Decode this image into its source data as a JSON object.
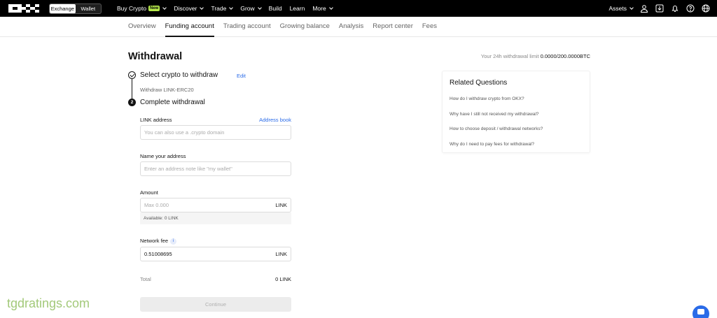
{
  "header": {
    "toggle": {
      "exchange": "Exchange",
      "wallet": "Wallet"
    },
    "nav": [
      {
        "label": "Buy Crypto",
        "badge": "New",
        "dropdown": true
      },
      {
        "label": "Discover",
        "dropdown": true
      },
      {
        "label": "Trade",
        "dropdown": true
      },
      {
        "label": "Grow",
        "dropdown": true
      },
      {
        "label": "Build",
        "dropdown": false
      },
      {
        "label": "Learn",
        "dropdown": false
      },
      {
        "label": "More",
        "dropdown": true
      }
    ],
    "assets": "Assets",
    "icons": [
      "user-icon",
      "download-icon",
      "bell-icon",
      "help-icon",
      "globe-icon"
    ]
  },
  "subnav": {
    "tabs": [
      "Overview",
      "Funding account",
      "Trading account",
      "Growing balance",
      "Analysis",
      "Report center",
      "Fees"
    ],
    "active": "Funding account"
  },
  "page": {
    "title": "Withdrawal",
    "limit_label": "Your 24h withdrawal limit",
    "limit_value": "0.0000/200.0000BTC"
  },
  "steps": {
    "step1_label": "Select crypto to withdraw",
    "edit": "Edit",
    "withdraw_what": "Withdraw LINK-ERC20",
    "step2_number": "2",
    "step2_label": "Complete withdrawal"
  },
  "form": {
    "address_label": "LINK address",
    "address_book": "Address book",
    "address_placeholder": "You can also use a .crypto domain",
    "name_label": "Name your address",
    "name_placeholder": "Enter an address note like \"my wallet\"",
    "amount_label": "Amount",
    "amount_placeholder": "Max 0.000",
    "amount_unit": "LINK",
    "available": "Available:  0 LINK",
    "fee_label": "Network fee",
    "fee_value": "0.51008695",
    "fee_unit": "LINK",
    "total_label": "Total",
    "total_value": "0 LINK",
    "continue": "Continue"
  },
  "related": {
    "title": "Related Questions",
    "items": [
      "How do I withdraw crypto from OKX?",
      "Why have I still not received my withdrawal?",
      "How to choose deposit / withdrawal networks?",
      "Why do I need to pay fees for withdrawal?"
    ]
  },
  "watermark": "tgdratings.com",
  "colors": {
    "accent": "#2a6be8",
    "badge": "#b6e94a",
    "topbar": "#000000"
  }
}
